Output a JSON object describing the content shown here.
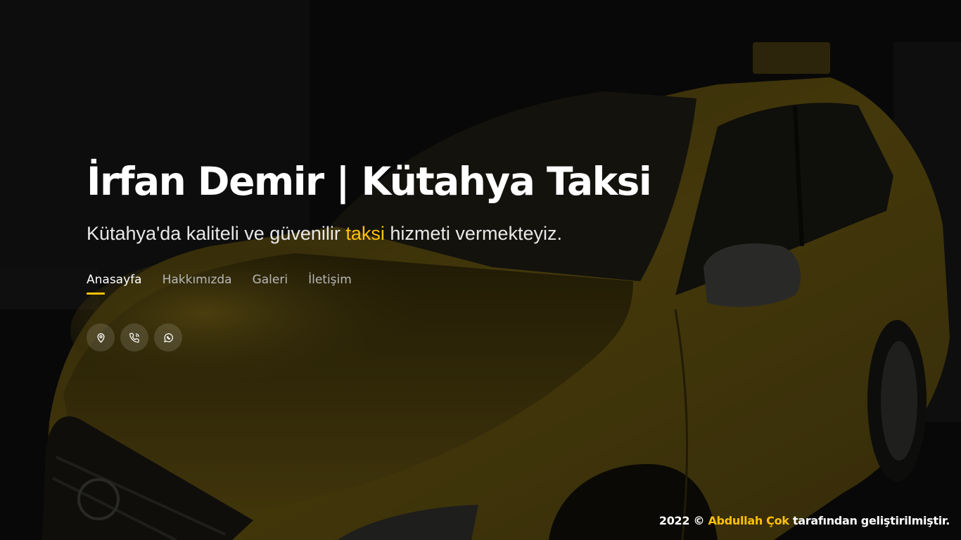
{
  "header": {
    "title": "İrfan Demir | Kütahya Taksi",
    "subtitle_before": "Kütahya'da kaliteli ve güvenilir ",
    "subtitle_highlight": "taksi",
    "subtitle_after": " hizmeti vermekteyiz."
  },
  "nav": {
    "items": [
      {
        "label": "Anasayfa",
        "active": true
      },
      {
        "label": "Hakkımızda",
        "active": false
      },
      {
        "label": "Galeri",
        "active": false
      },
      {
        "label": "İletişim",
        "active": false
      }
    ]
  },
  "social": {
    "icons": [
      "location-icon",
      "phone-icon",
      "whatsapp-icon"
    ]
  },
  "footer": {
    "prefix": "2022 © ",
    "author": "Abdullah Çok",
    "suffix": " tarafından geliştirilmiştir."
  },
  "colors": {
    "accent": "#ffc107",
    "background": "#0b0b0b",
    "car_yellow": "#6b5a12"
  }
}
